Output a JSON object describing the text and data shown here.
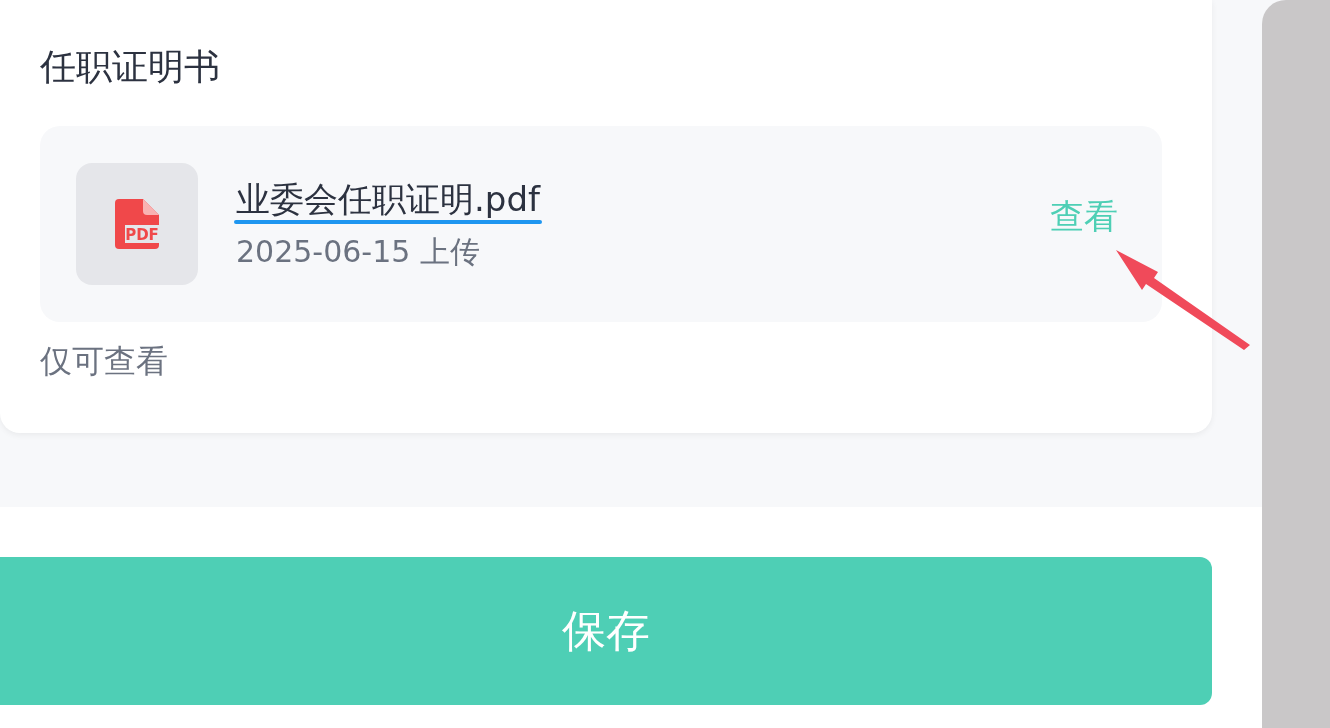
{
  "section": {
    "title": "任职证明书",
    "file": {
      "icon_label": "PDF",
      "name": "业委会任职证明.pdf",
      "meta": "2025-06-15 上传",
      "action": "查看"
    },
    "note": "仅可查看"
  },
  "save_button": {
    "label": "保存"
  },
  "annotations": {
    "underline_on_file_name": true,
    "arrow_to_view": true
  }
}
